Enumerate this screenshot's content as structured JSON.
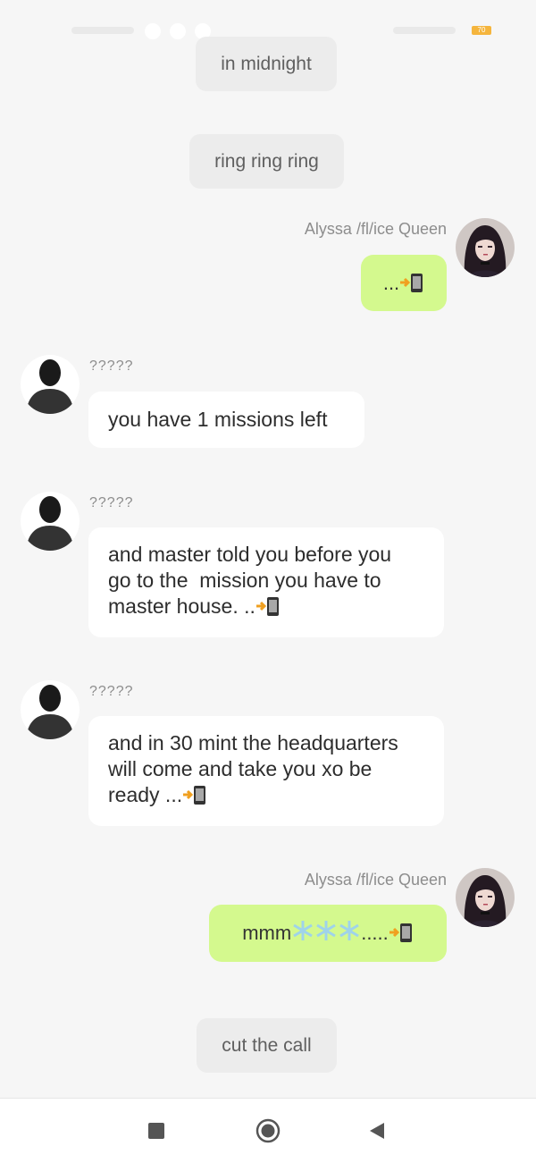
{
  "status_bar": {
    "battery": "70"
  },
  "system_messages": [
    "in midnight",
    "ring ring ring",
    "cut the call"
  ],
  "messages": [
    {
      "sender": "Alyssa /fl/ice Queen",
      "side": "right",
      "text": "...",
      "icon": "phone-arrow-icon"
    },
    {
      "sender": "?????",
      "side": "left",
      "text": "you have 1 missions left"
    },
    {
      "sender": "?????",
      "side": "left",
      "lines": [
        "and master told you before you",
        "go to the  mission you have to",
        "master house. .."
      ],
      "icon": "phone-arrow-icon"
    },
    {
      "sender": "?????",
      "side": "left",
      "lines": [
        "and in 30 mint the headquarters",
        "will come and take you xo be",
        "ready ..."
      ],
      "icon": "phone-arrow-icon"
    },
    {
      "sender": "Alyssa /fl/ice Queen",
      "side": "right",
      "text_before": "mmm",
      "snowflakes": 3,
      "text_after": ".....",
      "icon": "phone-arrow-icon"
    }
  ],
  "navigation": {
    "recents": "recents-square-icon",
    "home": "home-circle-icon",
    "back": "back-triangle-icon"
  }
}
